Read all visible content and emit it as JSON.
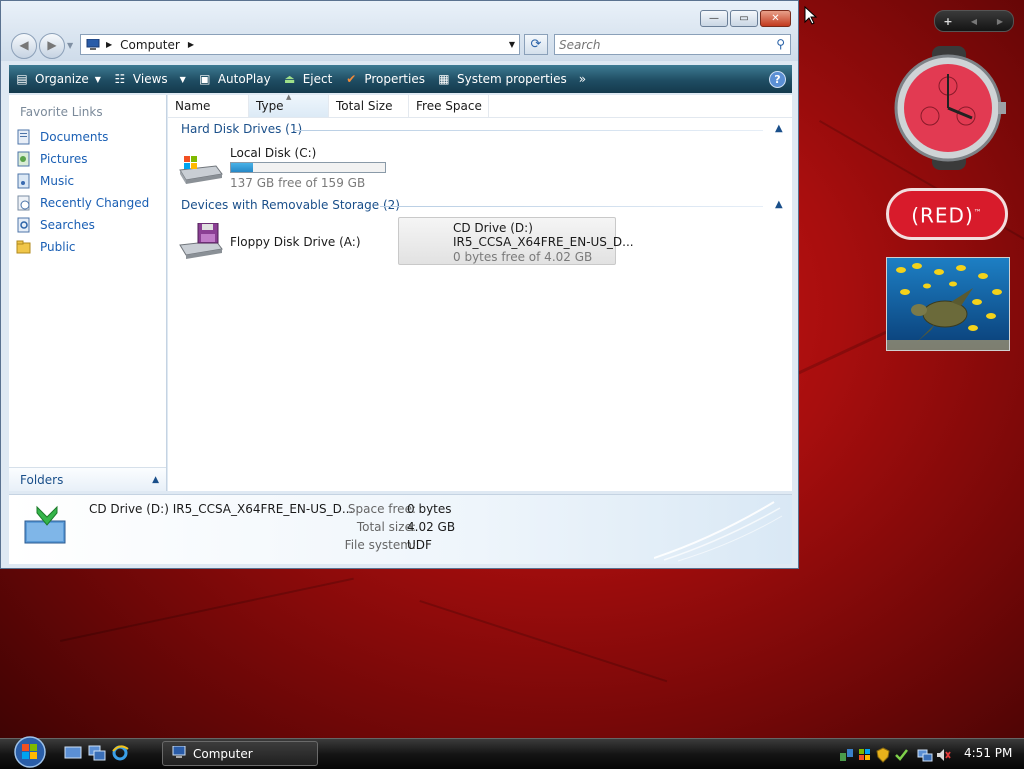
{
  "window": {
    "title_buttons": {
      "minimize": "—",
      "maximize": "▭",
      "close": "✕"
    },
    "nav": {
      "back": "◀",
      "forward": "▶"
    },
    "address": {
      "icon": "computer-icon",
      "path": "Computer"
    },
    "search": {
      "placeholder": "Search"
    },
    "toolbar": [
      {
        "label": "Organize",
        "has_caret": true
      },
      {
        "label": "Views",
        "has_caret": true
      },
      {
        "label": "AutoPlay"
      },
      {
        "label": "Eject"
      },
      {
        "label": "Properties"
      },
      {
        "label": "System properties"
      }
    ],
    "toolbar_more": "»",
    "help": "?",
    "favorite_links": {
      "header": "Favorite Links",
      "items": [
        "Documents",
        "Pictures",
        "Music",
        "Recently Changed",
        "Searches",
        "Public"
      ]
    },
    "folders_label": "Folders",
    "columns": [
      "Name",
      "Type",
      "Total Size",
      "Free Space"
    ],
    "groups": [
      {
        "label": "Hard Disk Drives (1)",
        "items": [
          {
            "name": "Local Disk (C:)",
            "free": "137 GB free of 159 GB",
            "usage_fraction": 0.14
          }
        ]
      },
      {
        "label": "Devices with Removable Storage (2)",
        "items": [
          {
            "name": "Floppy Disk Drive (A:)"
          },
          {
            "name": "CD Drive (D:)",
            "label": "IR5_CCSA_X64FRE_EN-US_D...",
            "free": "0 bytes free of 4.02 GB"
          }
        ]
      }
    ],
    "details": {
      "name": "CD Drive (D:) IR5_CCSA_X64FRE_EN-US_D...",
      "space_free_label": "Space free:",
      "space_free": "0 bytes",
      "total_size_label": "Total size:",
      "total_size": "4.02 GB",
      "file_system_label": "File system:",
      "file_system": "UDF"
    }
  },
  "gadgets": {
    "controls": {
      "add": "+",
      "prev": "◀",
      "next": "▶"
    },
    "red_label": "(RED)",
    "red_tm": "™"
  },
  "taskbar": {
    "active_window": "Computer",
    "clock": "4:51 PM"
  }
}
